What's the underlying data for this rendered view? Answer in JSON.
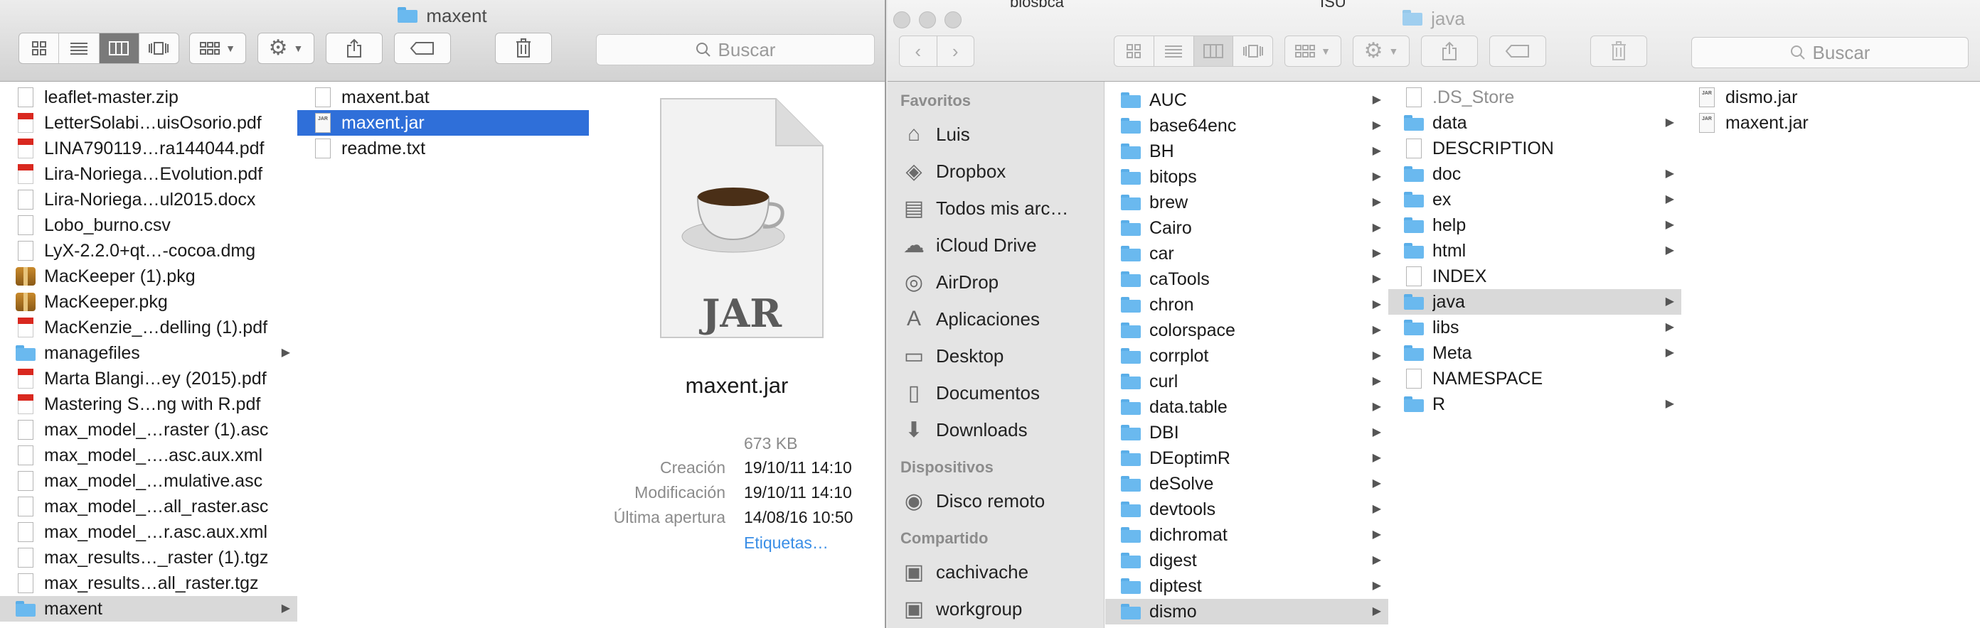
{
  "left_window": {
    "title": "maxent",
    "search_placeholder": "Buscar",
    "files": [
      {
        "name": "leaflet-master.zip",
        "type": "doc"
      },
      {
        "name": "LetterSolabi…uisOsorio.pdf",
        "type": "pdf"
      },
      {
        "name": "LINA790119…ra144044.pdf",
        "type": "pdf"
      },
      {
        "name": "Lira-Noriega…Evolution.pdf",
        "type": "pdf"
      },
      {
        "name": "Lira-Noriega…ul2015.docx",
        "type": "doc"
      },
      {
        "name": "Lobo_burno.csv",
        "type": "doc"
      },
      {
        "name": "LyX-2.2.0+qt…-cocoa.dmg",
        "type": "doc"
      },
      {
        "name": "MacKeeper (1).pkg",
        "type": "pkg"
      },
      {
        "name": "MacKeeper.pkg",
        "type": "pkg"
      },
      {
        "name": "MacKenzie_…delling (1).pdf",
        "type": "pdf"
      },
      {
        "name": "managefiles",
        "type": "folder"
      },
      {
        "name": "Marta Blangi…ey (2015).pdf",
        "type": "pdf"
      },
      {
        "name": "Mastering S…ng with R.pdf",
        "type": "pdf"
      },
      {
        "name": "max_model_…raster (1).asc",
        "type": "doc"
      },
      {
        "name": "max_model_….asc.aux.xml",
        "type": "doc"
      },
      {
        "name": "max_model_…mulative.asc",
        "type": "doc"
      },
      {
        "name": "max_model_…all_raster.asc",
        "type": "doc"
      },
      {
        "name": "max_model_…r.asc.aux.xml",
        "type": "doc"
      },
      {
        "name": "max_results…_raster (1).tgz",
        "type": "doc"
      },
      {
        "name": "max_results…all_raster.tgz",
        "type": "doc"
      },
      {
        "name": "maxent",
        "type": "folder"
      }
    ],
    "maxent_files": [
      "maxent.bat",
      "maxent.jar",
      "readme.txt"
    ],
    "preview": {
      "icon_label": "JAR",
      "name": "maxent.jar",
      "size": "673 KB",
      "creation_label": "Creación",
      "creation": "19/10/11 14:10",
      "modified_label": "Modificación",
      "modified": "19/10/11 14:10",
      "opened_label": "Última apertura",
      "opened": "14/08/16 10:50",
      "tags_link": "Etiquetas…"
    }
  },
  "right_window": {
    "title": "java",
    "search_placeholder": "Buscar",
    "tabs_partial": [
      "biosbca",
      "ISU"
    ],
    "sidebar": {
      "favorites_header": "Favoritos",
      "favorites": [
        "Luis",
        "Dropbox",
        "Todos mis arc…",
        "iCloud Drive",
        "AirDrop",
        "Aplicaciones",
        "Desktop",
        "Documentos",
        "Downloads"
      ],
      "devices_header": "Dispositivos",
      "devices": [
        "Disco remoto"
      ],
      "shared_header": "Compartido",
      "shared": [
        "cachivache",
        "workgroup"
      ]
    },
    "packages": [
      "AUC",
      "base64enc",
      "BH",
      "bitops",
      "brew",
      "Cairo",
      "car",
      "caTools",
      "chron",
      "colorspace",
      "corrplot",
      "curl",
      "data.table",
      "DBI",
      "DEoptimR",
      "deSolve",
      "devtools",
      "dichromat",
      "digest",
      "diptest",
      "dismo"
    ],
    "dismo_items": [
      {
        "name": ".DS_Store",
        "type": "doc",
        "dim": true
      },
      {
        "name": "data",
        "type": "folder"
      },
      {
        "name": "DESCRIPTION",
        "type": "doc"
      },
      {
        "name": "doc",
        "type": "folder"
      },
      {
        "name": "ex",
        "type": "folder"
      },
      {
        "name": "help",
        "type": "folder"
      },
      {
        "name": "html",
        "type": "folder"
      },
      {
        "name": "INDEX",
        "type": "doc"
      },
      {
        "name": "java",
        "type": "folder"
      },
      {
        "name": "libs",
        "type": "folder"
      },
      {
        "name": "Meta",
        "type": "folder"
      },
      {
        "name": "NAMESPACE",
        "type": "doc"
      },
      {
        "name": "R",
        "type": "folder"
      }
    ],
    "java_items": [
      "dismo.jar",
      "maxent.jar"
    ]
  },
  "colors": {
    "selection_blue": "#2f6fd9",
    "selection_gray": "#d9d9d9",
    "folder": "#6ab9ef",
    "link": "#3a8ee6"
  }
}
